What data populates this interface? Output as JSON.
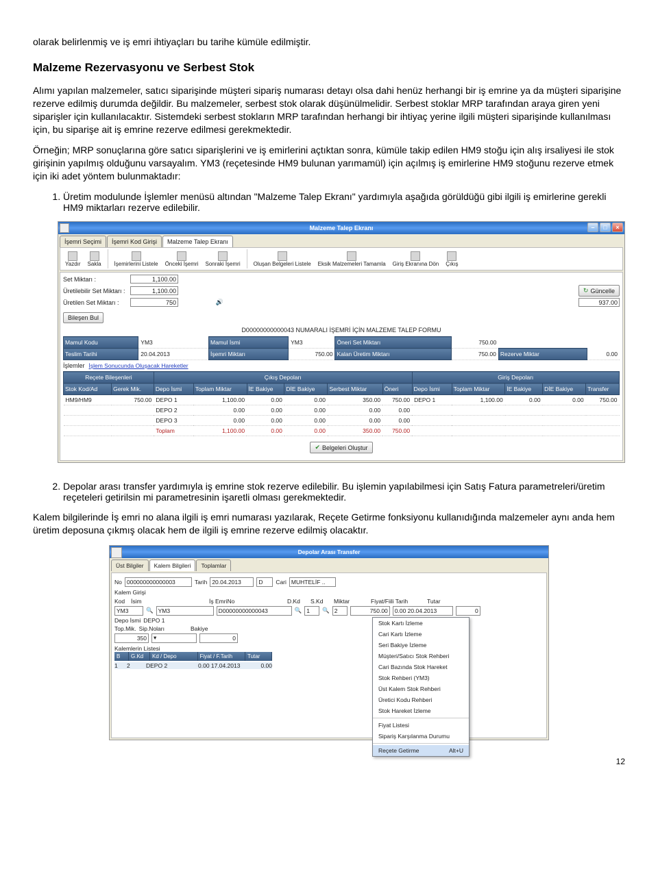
{
  "intro": "olarak belirlenmiş ve iş emri ihtiyaçları bu tarihe kümüle edilmiştir.",
  "heading": "Malzeme Rezervasyonu ve Serbest Stok",
  "para1": "Alımı yapılan malzemeler, satıcı siparişinde müşteri sipariş numarası detayı olsa dahi henüz herhangi bir iş emrine ya da müşteri siparişine rezerve edilmiş durumda değildir. Bu malzemeler, serbest stok olarak düşünülmelidir. Serbest stoklar MRP tarafından araya giren yeni siparişler için kullanılacaktır. Sistemdeki serbest stokların MRP tarafından herhangi bir ihtiyaç yerine ilgili müşteri siparişinde kullanılması için, bu siparişe ait iş emrine rezerve edilmesi  gerekmektedir.",
  "para2": "Örneğin; MRP sonuçlarına göre satıcı siparişlerini ve iş emirlerini açtıktan sonra, kümüle takip edilen HM9 stoğu için alış irsaliyesi ile stok girişinin yapılmış olduğunu varsayalım. YM3 (reçetesinde HM9 bulunan yarımamül) için açılmış iş emirlerine HM9 stoğunu rezerve etmek için iki adet yöntem bulunmaktadır:",
  "li1": "Üretim modulunde İşlemler menüsü altından \"Malzeme Talep Ekranı\" yardımıyla aşağıda görüldüğü gibi ilgili iş emirlerine gerekli HM9 miktarları rezerve edilebilir.",
  "li2": "Depolar arası transfer yardımıyla iş emrine stok rezerve edilebilir. Bu işlemin yapılabilmesi için Satış Fatura parametreleri/üretim reçeteleri getirilsin mi parametresinin işaretli olması gerekmektedir.",
  "para3": "Kalem bilgilerinde İş emri no alana  ilgili iş emri numarası yazılarak, Reçete Getirme fonksiyonu kullanıdığında malzemeler aynı anda hem üretim deposuna çıkmış olacak hem de ilgili iş emrine rezerve edilmiş olacaktır.",
  "page": "12",
  "s1": {
    "title": "Malzeme Talep Ekranı",
    "tabs": [
      "İşemri Seçimi",
      "İşemri Kod Girişi",
      "Malzeme Talep Ekranı"
    ],
    "toolbar": [
      "Yazdır",
      "Sakla",
      "İşemirlerini Listele",
      "Önceki İşemri",
      "Sonraki İşemri",
      "Oluşan Belgeleri Listele",
      "Eksik Malzemeleri Tamamla",
      "Giriş Ekranına Dön",
      "Çıkış"
    ],
    "setMiktarL": "Set Miktarı :",
    "setMiktarV": "1,100.00",
    "urtSetL": "Üretilebilir Set Miktarı :",
    "urtSetV": "1,100.00",
    "urtMikL": "Üretilen Set Miktarı :",
    "urtMikV": "750",
    "yuzde": "937.00",
    "guncelle": "Güncelle",
    "bilesen": "Bileşen Bul",
    "formTitle": "D00000000000043 NUMARALI İŞEMRİ İÇİN MALZEME TALEP FORMU",
    "infoH": [
      "Mamul Kodu",
      "Mamul İsmi",
      "Öneri Set Miktarı"
    ],
    "infoV": {
      "mamulKodu": "YM3",
      "mamulIsmi": "YM3",
      "oneri": "750.00"
    },
    "info2H": [
      "Teslim Tarihi",
      "İşemri Miktarı",
      "Kalan Üretim Miktarı",
      "Rezerve Miktar"
    ],
    "info2V": {
      "tarih": "20.04.2013",
      "iemik": "750.00",
      "kalan": "750.00",
      "rezerve": "0.00"
    },
    "islemler": "İşlemler",
    "islemLink": "İşlem Sonucunda Oluşacak Hareketler",
    "gh1": "Reçete Bileşenleri",
    "gh2": "Çıkış Depoları",
    "gh3": "Giriş Depoları",
    "cols": [
      "Stok Kod/Ad",
      "Gerek Mik.",
      "Depo İsmi",
      "Toplam Miktar",
      "İE Bakiye",
      "DİE Bakiye",
      "Serbest Miktar",
      "Öneri",
      "Depo İsmi",
      "Toplam Miktar",
      "İE Bakiye",
      "DİE Bakiye",
      "Transfer"
    ],
    "rows": [
      {
        "kod": "HM9/HM9",
        "gm": "750.00",
        "d": "DEPO 1",
        "tm": "1,100.00",
        "ie": "0.00",
        "die": "0.00",
        "sb": "350.00",
        "on": "750.00",
        "gd": "DEPO 1",
        "gtm": "1,100.00",
        "gie": "0.00",
        "gdie": "0.00",
        "tr": "750.00"
      },
      {
        "kod": "",
        "gm": "",
        "d": "DEPO 2",
        "tm": "0.00",
        "ie": "0.00",
        "die": "0.00",
        "sb": "0.00",
        "on": "0.00",
        "gd": "",
        "gtm": "",
        "gie": "",
        "gdie": "",
        "tr": ""
      },
      {
        "kod": "",
        "gm": "",
        "d": "DEPO 3",
        "tm": "0.00",
        "ie": "0.00",
        "die": "0.00",
        "sb": "0.00",
        "on": "0.00",
        "gd": "",
        "gtm": "",
        "gie": "",
        "gdie": "",
        "tr": ""
      }
    ],
    "tot": {
      "d": "Toplam",
      "tm": "1,100.00",
      "ie": "0.00",
      "die": "0.00",
      "sb": "350.00",
      "on": "750.00"
    },
    "footBtn": "Belgeleri Oluştur"
  },
  "s2": {
    "title": "Depolar Arası Transfer",
    "tabs": [
      "Üst Bilgiler",
      "Kalem Bilgileri",
      "Toplamlar"
    ],
    "noL": "No",
    "noV": "000000000000003",
    "tarihL": "Tarih",
    "tarihV": "20.04.2013",
    "d": "D",
    "cari": "Cari",
    "muh": "MUHTELİF ..",
    "kgL": "Kalem Girişi",
    "kodL": "Kod",
    "isimL": "İsim",
    "ienL": "İş EmriNo",
    "dkdL": "D.Kd",
    "skL": "S.Kd",
    "mkL": "Miktar",
    "ftL": "Fiyat/Fiili Tarih",
    "tuL": "Tutar",
    "kodV": "YM3",
    "isimV": "YM3",
    "ienV": "D00000000000043",
    "dkdV": "1",
    "skV": "2",
    "mkV": "750.00",
    "ft": "0.00 20.04.2013",
    "tu": "0",
    "depoL": "Depo İsmi",
    "depoV": "DEPO 1",
    "topL": "Top.Mik.",
    "topV": "350",
    "sipL": "Sip.Noları",
    "bakL": "Bakiye",
    "bakV": "0",
    "listL": "Kalemlerin Listesi",
    "hdr": [
      "B",
      "G.Kd",
      "Kd / Depo",
      "Fiyat / F.Tarih",
      "Tutar"
    ],
    "row": {
      "b": "1",
      "g": "2",
      "kd": "DEPO 2",
      "ft": "0.00 17.04.2013",
      "tu": "0.00"
    },
    "menu": [
      "Stok Kartı İzleme",
      "Cari Kartı İzleme",
      "Seri Bakiye İzleme",
      "Müşteri/Satıcı Stok Rehberi",
      "Cari Bazında Stok Hareket",
      "Stok Rehberi (YM3)",
      "Üst Kalem Stok Rehberi",
      "Üretici Kodu Rehberi",
      "Stok Hareket İzleme",
      "Fiyat Listesi",
      "Sipariş Karşılanma Durumu"
    ],
    "menuSel": "Reçete Getirme",
    "menuHk": "Alt+U"
  }
}
